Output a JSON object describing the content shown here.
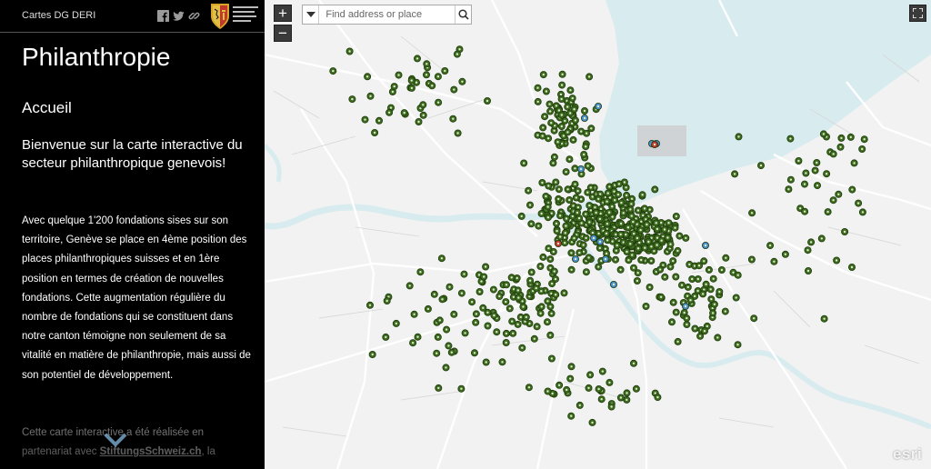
{
  "app": {
    "title": "Cartes DG DERI",
    "logo_icon": "republique-canton-geneve-logo"
  },
  "share": [
    {
      "name": "facebook-icon"
    },
    {
      "name": "twitter-icon"
    },
    {
      "name": "link-icon"
    }
  ],
  "panel": {
    "title": "Philanthropie",
    "section": "Accueil",
    "intro": "Bienvenue sur la carte interactive du secteur philanthropique genevois!",
    "body": "Avec quelque 1'200 fondations sises sur son territoire, Genève se place en 4ème position des places philanthropiques suisses et en 1ère position en termes de création de nouvelles fondations. Cette augmentation régulière du nombre de fondations qui se constituent dans notre canton témoigne non seulement de sa vitalité en matière de philanthropie, mais aussi de son potentiel de développement.",
    "body2_before": "Cette carte interactive a été réalisée en partenariat avec ",
    "body2_link": "StiftungsSchweiz.ch",
    "body2_after": ", la"
  },
  "map": {
    "zoom_in": "+",
    "zoom_out": "−",
    "search_placeholder": "Find address or place",
    "attribution": "esri",
    "marker_color": "#3d6b1e",
    "marker_alt_color": "#4a90c8",
    "marker_highlight_color": "#c0392b",
    "water_color": "#d8ecef",
    "land_color": "#f2f2f2"
  }
}
